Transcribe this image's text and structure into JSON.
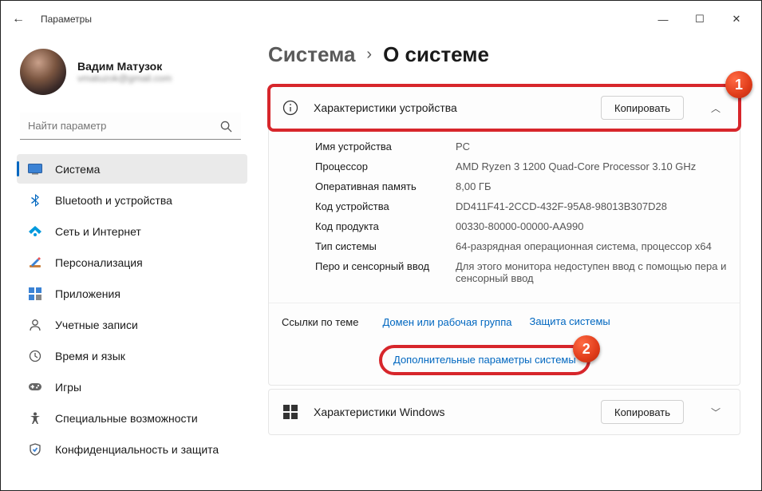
{
  "window": {
    "title": "Параметры"
  },
  "user": {
    "name": "Вадим Матузок",
    "email": "vmatuzok@gmail.com"
  },
  "search": {
    "placeholder": "Найти параметр"
  },
  "sidebar": {
    "items": [
      {
        "label": "Система"
      },
      {
        "label": "Bluetooth и устройства"
      },
      {
        "label": "Сеть и Интернет"
      },
      {
        "label": "Персонализация"
      },
      {
        "label": "Приложения"
      },
      {
        "label": "Учетные записи"
      },
      {
        "label": "Время и язык"
      },
      {
        "label": "Игры"
      },
      {
        "label": "Специальные возможности"
      },
      {
        "label": "Конфиденциальность и защита"
      }
    ]
  },
  "breadcrumb": {
    "section": "Система",
    "page": "О системе"
  },
  "device_card": {
    "title": "Характеристики устройства",
    "copy": "Копировать",
    "specs": [
      {
        "k": "Имя устройства",
        "v": "PC"
      },
      {
        "k": "Процессор",
        "v": "AMD Ryzen 3 1200 Quad-Core Processor 3.10 GHz"
      },
      {
        "k": "Оперативная память",
        "v": "8,00 ГБ"
      },
      {
        "k": "Код устройства",
        "v": "DD411F41-2CCD-432F-95A8-98013B307D28"
      },
      {
        "k": "Код продукта",
        "v": "00330-80000-00000-AA990"
      },
      {
        "k": "Тип системы",
        "v": "64-разрядная операционная система, процессор x64"
      },
      {
        "k": "Перо и сенсорный ввод",
        "v": "Для этого монитора недоступен ввод с помощью пера и сенсорный ввод"
      }
    ]
  },
  "links": {
    "title": "Ссылки по теме",
    "l1": "Домен или рабочая группа",
    "l2": "Защита системы",
    "l3": "Дополнительные параметры системы"
  },
  "windows_card": {
    "title": "Характеристики Windows",
    "copy": "Копировать"
  },
  "markers": {
    "m1": "1",
    "m2": "2"
  }
}
